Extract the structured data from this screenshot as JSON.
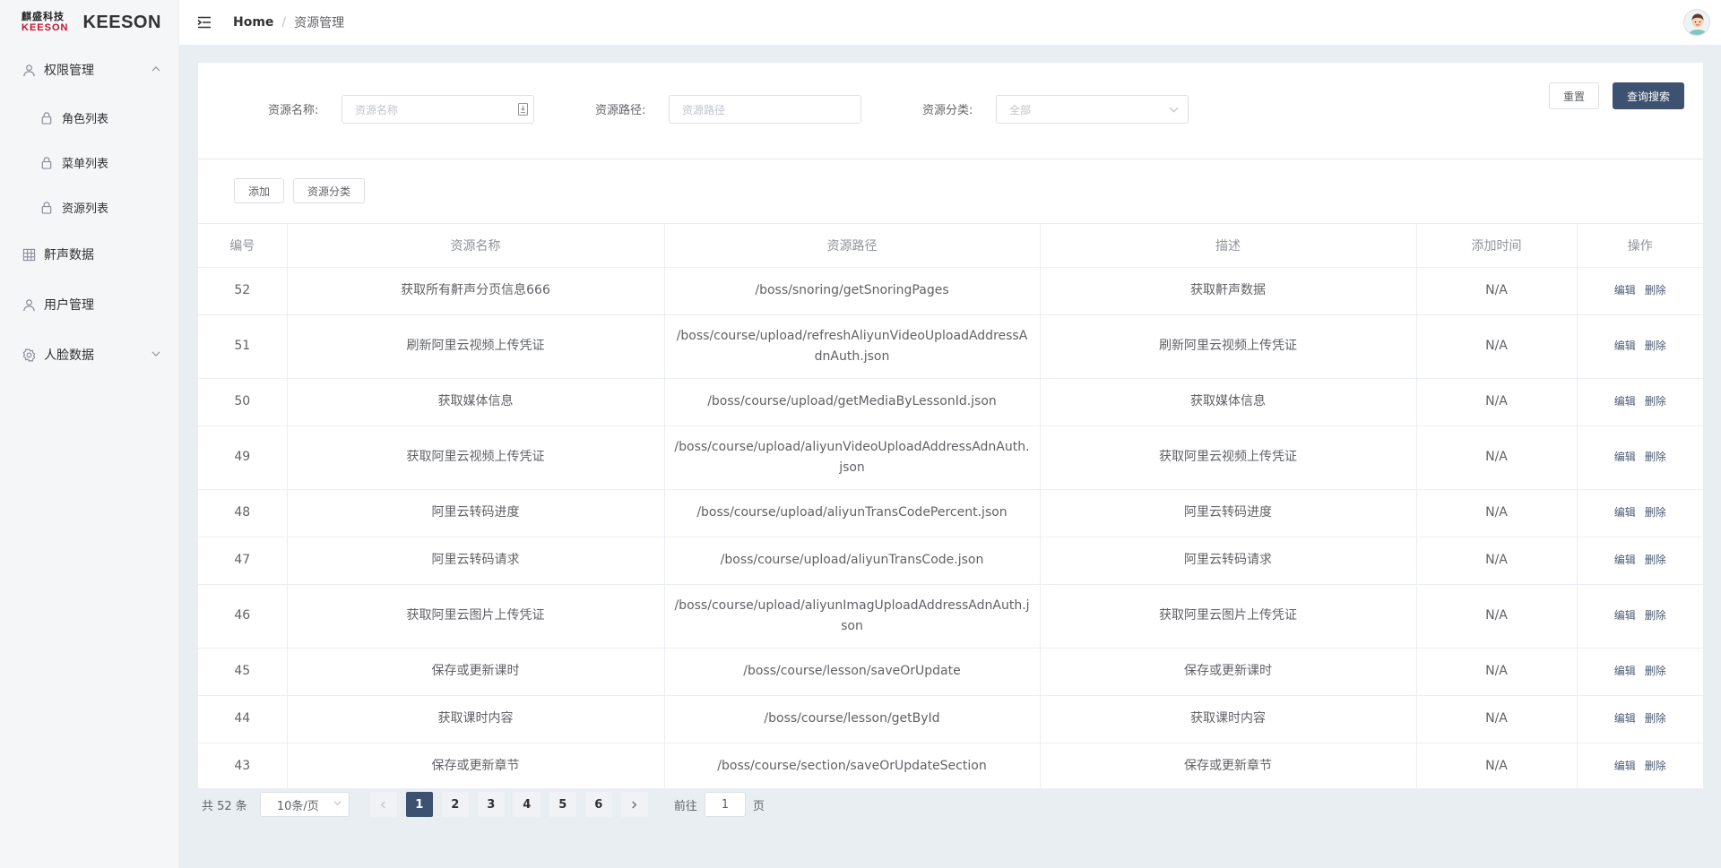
{
  "logo": {
    "cn": "麒盛科技",
    "en": "KEESON",
    "brand": "KEESON"
  },
  "breadcrumb": {
    "home": "Home",
    "separator": "/",
    "current": "资源管理"
  },
  "sidebar": {
    "groups": [
      {
        "label": "权限管理",
        "icon": "user-icon",
        "expanded": true,
        "items": [
          {
            "label": "角色列表",
            "icon": "lock-icon"
          },
          {
            "label": "菜单列表",
            "icon": "lock-icon"
          },
          {
            "label": "资源列表",
            "icon": "lock-icon"
          }
        ]
      },
      {
        "label": "鼾声数据",
        "icon": "grid-icon"
      },
      {
        "label": "用户管理",
        "icon": "user-icon"
      },
      {
        "label": "人脸数据",
        "icon": "settings-icon",
        "expanded": false
      }
    ]
  },
  "search": {
    "name_label": "资源名称:",
    "name_placeholder": "资源名称",
    "path_label": "资源路径:",
    "path_placeholder": "资源路径",
    "category_label": "资源分类:",
    "category_value": "全部",
    "reset_label": "重置",
    "query_label": "查询搜索"
  },
  "toolbar": {
    "add_label": "添加",
    "category_label": "资源分类"
  },
  "table": {
    "headers": [
      "编号",
      "资源名称",
      "资源路径",
      "描述",
      "添加时间",
      "操作"
    ],
    "edit_label": "编辑",
    "delete_label": "删除",
    "rows": [
      {
        "id": "52",
        "name": "获取所有鼾声分页信息666",
        "path": "/boss/snoring/getSnoringPages",
        "desc": "获取鼾声数据",
        "time": "N/A"
      },
      {
        "id": "51",
        "name": "刷新阿里云视频上传凭证",
        "path": "/boss/course/upload/refreshAliyunVideoUploadAddressAdnAuth.json",
        "desc": "刷新阿里云视频上传凭证",
        "time": "N/A"
      },
      {
        "id": "50",
        "name": "获取媒体信息",
        "path": "/boss/course/upload/getMediaByLessonId.json",
        "desc": "获取媒体信息",
        "time": "N/A"
      },
      {
        "id": "49",
        "name": "获取阿里云视频上传凭证",
        "path": "/boss/course/upload/aliyunVideoUploadAddressAdnAuth.json",
        "desc": "获取阿里云视频上传凭证",
        "time": "N/A"
      },
      {
        "id": "48",
        "name": "阿里云转码进度",
        "path": "/boss/course/upload/aliyunTransCodePercent.json",
        "desc": "阿里云转码进度",
        "time": "N/A"
      },
      {
        "id": "47",
        "name": "阿里云转码请求",
        "path": "/boss/course/upload/aliyunTransCode.json",
        "desc": "阿里云转码请求",
        "time": "N/A"
      },
      {
        "id": "46",
        "name": "获取阿里云图片上传凭证",
        "path": "/boss/course/upload/aliyunImagUploadAddressAdnAuth.json",
        "desc": "获取阿里云图片上传凭证",
        "time": "N/A"
      },
      {
        "id": "45",
        "name": "保存或更新课时",
        "path": "/boss/course/lesson/saveOrUpdate",
        "desc": "保存或更新课时",
        "time": "N/A"
      },
      {
        "id": "44",
        "name": "获取课时内容",
        "path": "/boss/course/lesson/getById",
        "desc": "获取课时内容",
        "time": "N/A"
      },
      {
        "id": "43",
        "name": "保存或更新章节",
        "path": "/boss/course/section/saveOrUpdateSection",
        "desc": "保存或更新章节",
        "time": "N/A"
      }
    ]
  },
  "pagination": {
    "total_text": "共 52 条",
    "page_size": "10条/页",
    "pages": [
      "1",
      "2",
      "3",
      "4",
      "5",
      "6"
    ],
    "current_page": "1",
    "goto_prefix": "前往",
    "goto_value": "1",
    "goto_suffix": "页"
  },
  "colors": {
    "primary": "#3d5170",
    "background": "#e9eef3",
    "sidebar": "#f5f6f8"
  }
}
